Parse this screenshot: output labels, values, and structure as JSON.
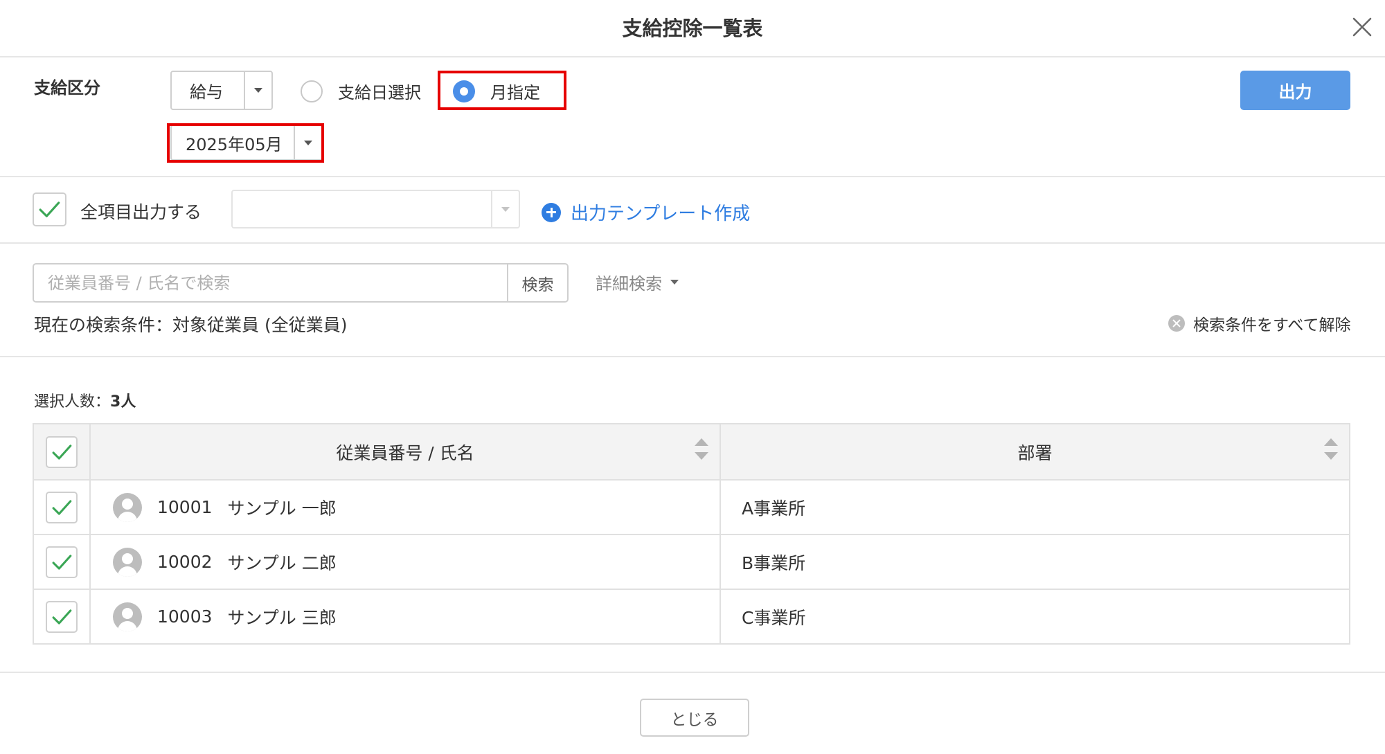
{
  "dialog": {
    "title": "支給控除一覧表"
  },
  "payment": {
    "label": "支給区分",
    "type_value": "給与",
    "radio_paydate_label": "支給日選択",
    "radio_month_label": "月指定",
    "selected_radio": "month",
    "month_value": "2025年05月",
    "output_button": "出力"
  },
  "options": {
    "all_items_label": "全項目出力する",
    "all_items_checked": true,
    "template_value": "",
    "create_template_link": "出力テンプレート作成"
  },
  "search": {
    "placeholder": "従業員番号 / 氏名で検索",
    "button": "検索",
    "detail_search": "詳細検索",
    "current_condition": "現在の検索条件：対象従業員 (全従業員)",
    "clear_all": "検索条件をすべて解除"
  },
  "selection": {
    "label": "選択人数：",
    "count": "3人"
  },
  "table": {
    "columns": [
      "従業員番号 / 氏名",
      "部署"
    ],
    "rows": [
      {
        "id": "10001",
        "name": "サンプル 一郎",
        "dept": "A事業所",
        "checked": true
      },
      {
        "id": "10002",
        "name": "サンプル 二郎",
        "dept": "B事業所",
        "checked": true
      },
      {
        "id": "10003",
        "name": "サンプル 三郎",
        "dept": "C事業所",
        "checked": true
      }
    ]
  },
  "footer": {
    "close_button": "とじる"
  },
  "colors": {
    "primary": "#5a9ae6",
    "link": "#2f7de1",
    "check": "#3aa655",
    "highlight": "#e60000"
  },
  "icons": [
    "close-icon",
    "chevron-down-icon",
    "radio-icon",
    "checkmark-icon",
    "plus-circle-icon",
    "clear-circle-icon",
    "sort-icon",
    "avatar-icon"
  ]
}
